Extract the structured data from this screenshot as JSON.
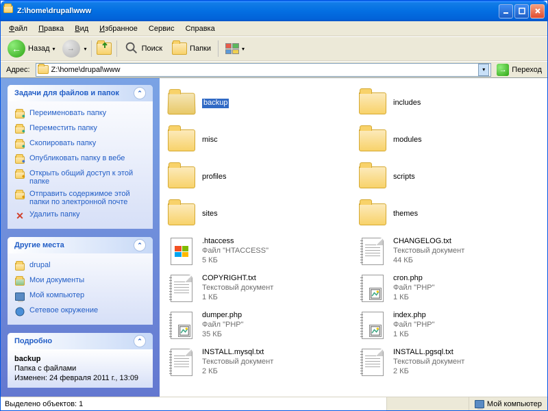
{
  "window": {
    "title": "Z:\\home\\drupal\\www"
  },
  "menu": {
    "file": "Файл",
    "edit": "Правка",
    "view": "Вид",
    "favorites": "Избранное",
    "tools": "Сервис",
    "help": "Справка"
  },
  "toolbar": {
    "back": "Назад",
    "search": "Поиск",
    "folders": "Папки"
  },
  "address": {
    "label": "Адрес:",
    "path": "Z:\\home\\drupal\\www",
    "go": "Переход"
  },
  "sidebar": {
    "tasks_title": "Задачи для файлов и папок",
    "tasks": [
      {
        "label": "Переименовать папку"
      },
      {
        "label": "Переместить папку"
      },
      {
        "label": "Скопировать папку"
      },
      {
        "label": "Опубликовать папку в вебе"
      },
      {
        "label": "Открыть общий доступ к этой папке"
      },
      {
        "label": "Отправить содержимое этой папки по электронной почте"
      },
      {
        "label": "Удалить папку"
      }
    ],
    "places_title": "Другие места",
    "places": [
      {
        "label": "drupal"
      },
      {
        "label": "Мои документы"
      },
      {
        "label": "Мой компьютер"
      },
      {
        "label": "Сетевое окружение"
      }
    ],
    "details_title": "Подробно",
    "details": {
      "name": "backup",
      "kind": "Папка с файлами",
      "mod_label": "Изменен: 24 февраля 2011 г., 13:09"
    }
  },
  "files": [
    {
      "name": "backup",
      "icon": "folder-open",
      "selected": true
    },
    {
      "name": "includes",
      "icon": "folder"
    },
    {
      "name": "misc",
      "icon": "folder"
    },
    {
      "name": "modules",
      "icon": "folder"
    },
    {
      "name": "profiles",
      "icon": "folder"
    },
    {
      "name": "scripts",
      "icon": "folder"
    },
    {
      "name": "sites",
      "icon": "folder"
    },
    {
      "name": "themes",
      "icon": "folder"
    },
    {
      "name": ".htaccess",
      "icon": "win",
      "type": "Файл \"HTACCESS\"",
      "size": "5 КБ"
    },
    {
      "name": "CHANGELOG.txt",
      "icon": "txt",
      "type": "Текстовый документ",
      "size": "44 КБ"
    },
    {
      "name": "COPYRIGHT.txt",
      "icon": "txt",
      "type": "Текстовый документ",
      "size": "1 КБ"
    },
    {
      "name": "cron.php",
      "icon": "php",
      "type": "Файл \"PHP\"",
      "size": "1 КБ"
    },
    {
      "name": "dumper.php",
      "icon": "php",
      "type": "Файл \"PHP\"",
      "size": "35 КБ"
    },
    {
      "name": "index.php",
      "icon": "php",
      "type": "Файл \"PHP\"",
      "size": "1 КБ"
    },
    {
      "name": "INSTALL.mysql.txt",
      "icon": "txt",
      "type": "Текстовый документ",
      "size": "2 КБ"
    },
    {
      "name": "INSTALL.pgsql.txt",
      "icon": "txt",
      "type": "Текстовый документ",
      "size": "2 КБ"
    }
  ],
  "status": {
    "selected": "Выделено объектов: 1",
    "location": "Мой компьютер"
  }
}
